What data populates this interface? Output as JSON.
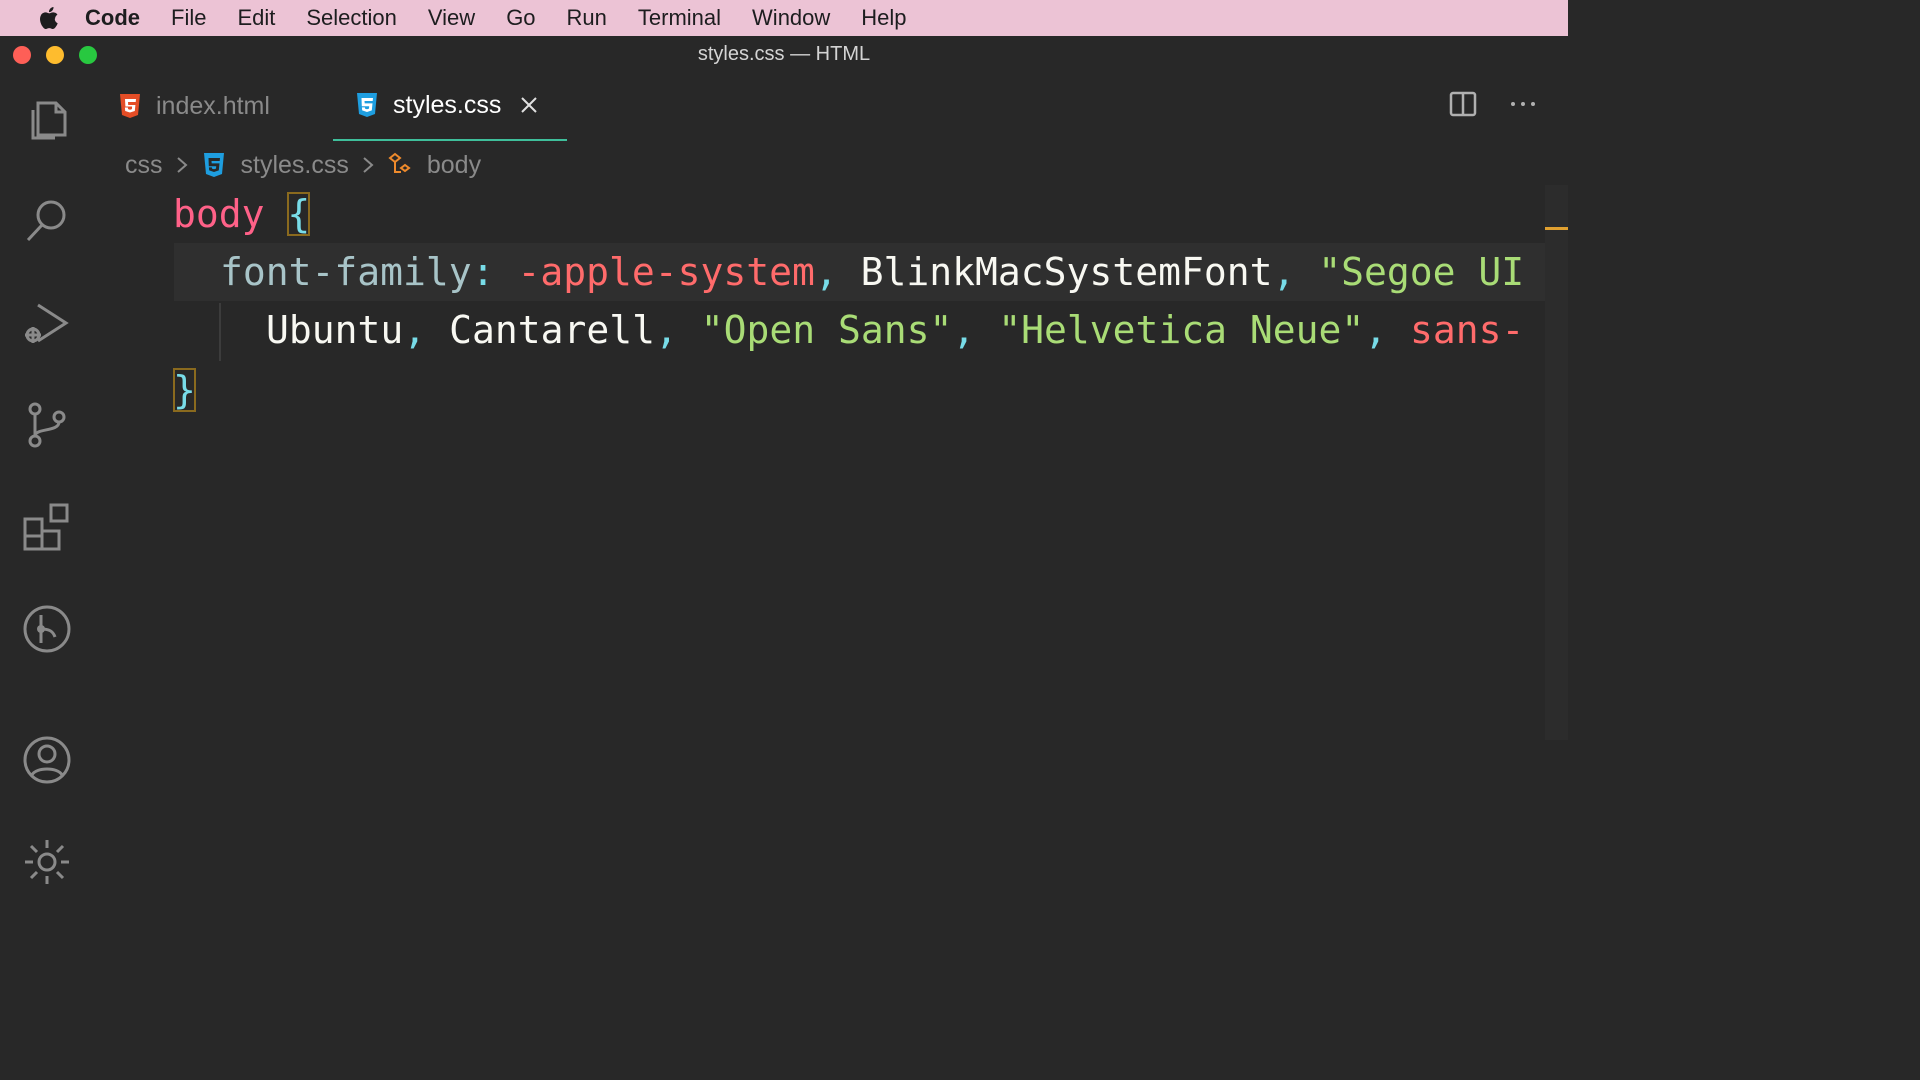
{
  "menubar": {
    "app": "Code",
    "items": [
      "File",
      "Edit",
      "Selection",
      "View",
      "Go",
      "Run",
      "Terminal",
      "Window",
      "Help"
    ]
  },
  "window": {
    "title": "styles.css — HTML"
  },
  "activity_bar": {
    "icons": [
      "files-icon",
      "search-icon",
      "run-debug-icon",
      "source-control-icon",
      "extensions-icon",
      "git-graph-icon",
      "account-icon",
      "settings-gear-icon"
    ]
  },
  "tabs": [
    {
      "label": "index.html",
      "icon": "html5-icon",
      "active": false
    },
    {
      "label": "styles.css",
      "icon": "css3-icon",
      "active": true
    }
  ],
  "breadcrumb": {
    "folder": "css",
    "file": "styles.css",
    "symbol": "body"
  },
  "code": {
    "selector": "body",
    "open_brace": "{",
    "property": "font-family",
    "colon": ":",
    "line2_values": [
      "-apple-system",
      "BlinkMacSystemFont",
      "\"Segoe UI"
    ],
    "line3_values": [
      "Ubuntu",
      "Cantarell",
      "\"Open Sans\"",
      "\"Helvetica Neue\"",
      "sans-"
    ],
    "comma": ",",
    "close_brace": "}"
  },
  "colors": {
    "menubar_bg": "#ecc3d5",
    "editor_bg": "#282828",
    "active_tab_border": "#3fbf9b",
    "selector": "#ff6188",
    "string": "#a9dc76",
    "keyword_value": "#ff6b6b"
  }
}
